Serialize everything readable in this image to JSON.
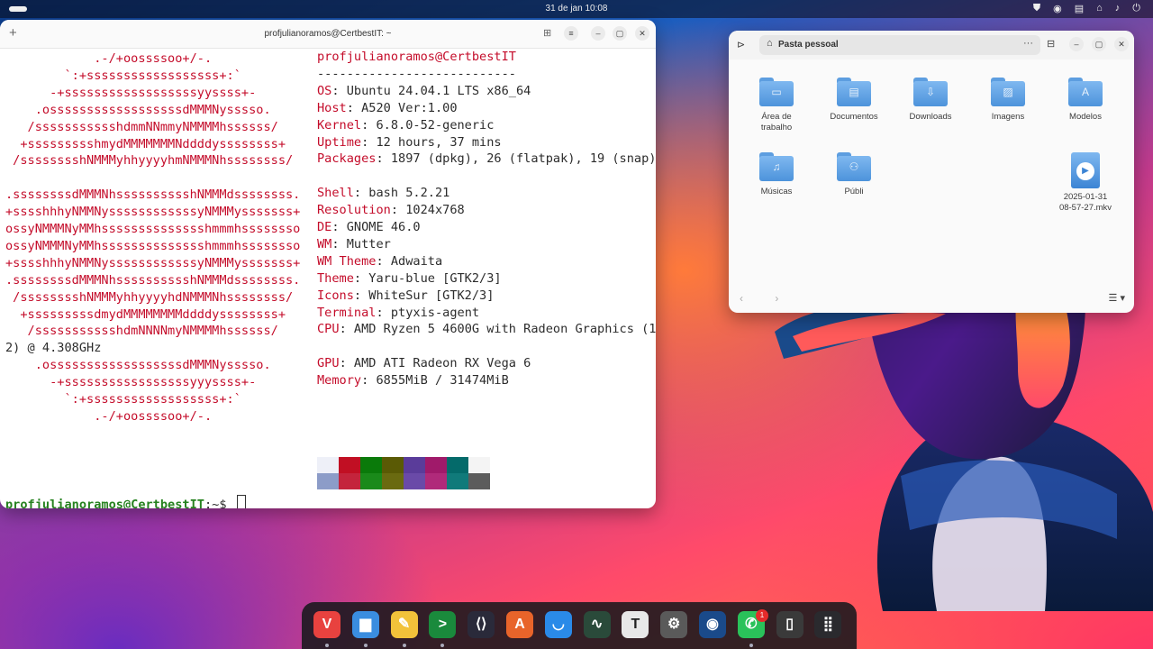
{
  "topbar": {
    "clock": "31 de jan  10:08",
    "tray_icons": [
      "shield-icon",
      "chrome-icon",
      "clipboard-icon",
      "network-icon",
      "volume-icon",
      "power-icon"
    ]
  },
  "terminal": {
    "title": "profjulianoramos@CertbestIT: ~",
    "logo_lines": [
      "            .-/+oossssoo+/-.",
      "        `:+ssssssssssssssssss+:`",
      "      -+ssssssssssssssssssyyssss+-",
      "    .ossssssssssssssssssdMMMNysssso.",
      "   /ssssssssssshdmmNNmmyNMMMMhssssss/",
      "  +ssssssssshmydMMMMMMMNddddyssssssss+",
      " /sssssssshNMMMyhhyyyyhmNMMMNhssssssss/",
      "",
      ".ssssssssdMMMNhsssssssssshNMMMdssssssss.",
      "+sssshhhyNMMNyssssssssssssyNMMMysssssss+",
      "ossyNMMMNyMMhsssssssssssssshmmmhssssssso",
      "ossyNMMMNyMMhsssssssssssssshmmmhssssssso",
      "+sssshhhyNMMNyssssssssssssyNMMMysssssss+",
      ".ssssssssdMMMNhsssssssssshNMMMdssssssss.",
      " /sssssssshNMMMyhhyyyyhdNMMMNhssssssss/",
      "  +sssssssssdmydMMMMMMMMddddyssssssss+",
      "   /ssssssssssshdmNNNNmyNMMMMhssssss/",
      "2) @ 4.308GHz",
      "    .ossssssssssssssssssdMMMNysssso.",
      "      -+sssssssssssssssssyyyssss+-",
      "        `:+ssssssssssssssssss+:`",
      "            .-/+oossssoo+/-."
    ],
    "user_host": "profjulianoramos@CertbestIT",
    "separator": "---------------------------",
    "info": [
      {
        "key": "OS",
        "value": "Ubuntu 24.04.1 LTS x86_64"
      },
      {
        "key": "Host",
        "value": "A520 Ver:1.00"
      },
      {
        "key": "Kernel",
        "value": "6.8.0-52-generic"
      },
      {
        "key": "Uptime",
        "value": "12 hours, 37 mins"
      },
      {
        "key": "Packages",
        "value": "1897 (dpkg), 26 (flatpak), 19 (snap)"
      },
      {
        "key": "Shell",
        "value": "bash 5.2.21"
      },
      {
        "key": "Resolution",
        "value": "1024x768"
      },
      {
        "key": "DE",
        "value": "GNOME 46.0"
      },
      {
        "key": "WM",
        "value": "Mutter"
      },
      {
        "key": "WM Theme",
        "value": "Adwaita"
      },
      {
        "key": "Theme",
        "value": "Yaru-blue [GTK2/3]"
      },
      {
        "key": "Icons",
        "value": "WhiteSur [GTK2/3]"
      },
      {
        "key": "Terminal",
        "value": "ptyxis-agent"
      },
      {
        "key": "CPU",
        "value": "AMD Ryzen 5 4600G with Radeon Graphics (1"
      },
      {
        "key": "GPU",
        "value": "AMD ATI Radeon RX Vega 6"
      },
      {
        "key": "Memory",
        "value": "6855MiB / 31474MiB"
      }
    ],
    "palette_colors": [
      "#eef0f8",
      "#c10f23",
      "#0a7a0a",
      "#5a5a05",
      "#5a3c9a",
      "#a01a6a",
      "#046a6a",
      "#f4f4f4",
      "#8c9cc8",
      "#c4243c",
      "#1a8a1a",
      "#6a6a10",
      "#6a4aa8",
      "#b02a7a",
      "#107a7a",
      "#5c5c5c"
    ],
    "prompt_user": "profjulianoramos@CertbestIT",
    "prompt_path": ":~$ "
  },
  "files": {
    "location": "Pasta pessoal",
    "items": [
      {
        "label": "Área de\ntrabalho",
        "glyph": "▭"
      },
      {
        "label": "Documentos",
        "glyph": "▤"
      },
      {
        "label": "Downloads",
        "glyph": "⇩"
      },
      {
        "label": "Imagens",
        "glyph": "▨"
      },
      {
        "label": "Modelos",
        "glyph": "A"
      },
      {
        "label": "Músicas",
        "glyph": "♫"
      },
      {
        "label": "Públi",
        "glyph": "⚇"
      },
      {
        "label": "",
        "glyph": ""
      },
      {
        "label": "",
        "glyph": ""
      },
      {
        "label": "2025-01-31\n08-57-27.mkv",
        "glyph": "▶"
      }
    ]
  },
  "dock": {
    "apps": [
      {
        "name": "vivaldi",
        "glyph": "V",
        "color": "#e8423f"
      },
      {
        "name": "files",
        "glyph": "▆",
        "color": "#3a8de0"
      },
      {
        "name": "text-editor",
        "glyph": "✎",
        "color": "#f2c23a"
      },
      {
        "name": "terminal",
        "glyph": ">",
        "color": "#1a8a3c"
      },
      {
        "name": "vscode",
        "glyph": "⟨⟩",
        "color": "#2a2a3a"
      },
      {
        "name": "app-center",
        "glyph": "A",
        "color": "#e8642a"
      },
      {
        "name": "store",
        "glyph": "◡",
        "color": "#2a8ae8"
      },
      {
        "name": "system-monitor",
        "glyph": "∿",
        "color": "#2a4a3a"
      },
      {
        "name": "typora",
        "glyph": "T",
        "color": "#e8e8e8"
      },
      {
        "name": "settings",
        "glyph": "⚙",
        "color": "#5a5a5a"
      },
      {
        "name": "steam",
        "glyph": "◉",
        "color": "#1a4a8a"
      },
      {
        "name": "whatsapp",
        "glyph": "✆",
        "color": "#2ac25a"
      },
      {
        "name": "trash",
        "glyph": "▯",
        "color": "#3a3a3a"
      },
      {
        "name": "show-apps",
        "glyph": "⣿",
        "color": "#2a2a2e"
      }
    ],
    "whatsapp_badge": "1"
  }
}
